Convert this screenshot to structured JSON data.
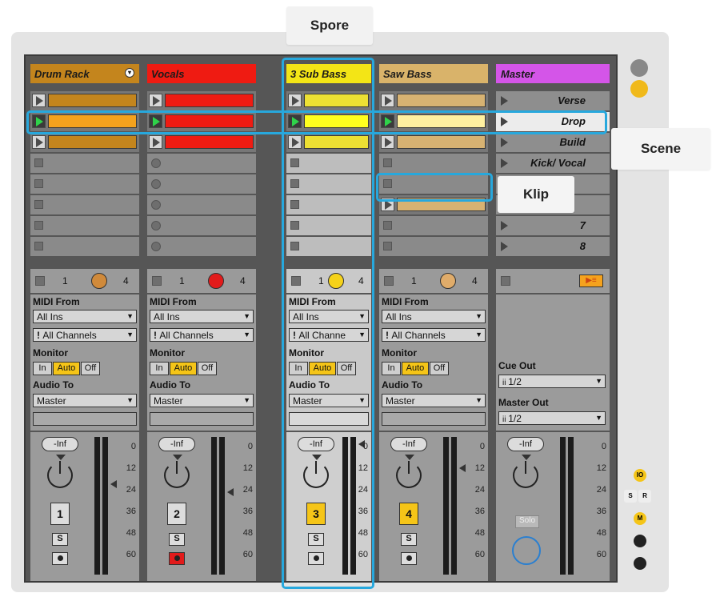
{
  "callouts": {
    "track": "Spore",
    "scene": "Scene",
    "clip": "Klip"
  },
  "tracks": [
    {
      "name": "Drum Rack",
      "num": "1",
      "color": "#c4851d",
      "clip_color": "#c4851d",
      "playing_clip_color": "#f4a21d",
      "dot_color": "#d08a3b",
      "slot_type": "square",
      "armed": false,
      "record": false,
      "selected": false,
      "midi_from": "All Ins",
      "channels": "All Channels",
      "audio_to": "Master"
    },
    {
      "name": "Vocals",
      "num": "2",
      "color": "#ef1b12",
      "clip_color": "#ef1b12",
      "playing_clip_color": "#ef1b12",
      "dot_color": "#e21b1b",
      "slot_type": "dot",
      "armed": false,
      "record": true,
      "selected": false,
      "midi_from": "All Ins",
      "channels": "All Channels",
      "audio_to": "Master"
    },
    {
      "name": "3 Sub Bass",
      "num": "3",
      "color": "#f3e516",
      "clip_color": "#ede033",
      "playing_clip_color": "#ffff1e",
      "dot_color": "#f5d21a",
      "slot_type": "square",
      "armed": true,
      "record": false,
      "selected": true,
      "midi_from": "All Ins",
      "channels": "All Channe",
      "audio_to": "Master"
    },
    {
      "name": "Saw Bass",
      "num": "4",
      "color": "#d9b36a",
      "clip_color": "#d7b272",
      "playing_clip_color": "#fff0a0",
      "dot_color": "#e0ac6a",
      "slot_type": "square",
      "armed": true,
      "record": false,
      "selected": false,
      "midi_from": "All Ins",
      "channels": "All Channels",
      "audio_to": "Master"
    }
  ],
  "io_labels": {
    "midi_from": "MIDI From",
    "monitor": "Monitor",
    "in": "In",
    "auto": "Auto",
    "off": "Off",
    "audio_to": "Audio To"
  },
  "status": {
    "n1": "1",
    "n4": "4"
  },
  "mixer": {
    "volume": "-Inf",
    "solo": "S",
    "scale": [
      "0",
      "12",
      "24",
      "36",
      "48",
      "60"
    ]
  },
  "master": {
    "name": "Master",
    "scenes": [
      "Verse",
      "Drop",
      "Build",
      "Kick/ Vocal",
      "",
      "",
      "7",
      "8"
    ],
    "cue_out_label": "Cue Out",
    "cue_out": "1/2",
    "master_out_label": "Master Out",
    "master_out": "1/2",
    "solo_label": "Solo"
  },
  "colors": {
    "highlight": "#27a8dd",
    "master": "#d455e8",
    "play_green": "#2fd24a",
    "auto_on": "#f5c518"
  }
}
